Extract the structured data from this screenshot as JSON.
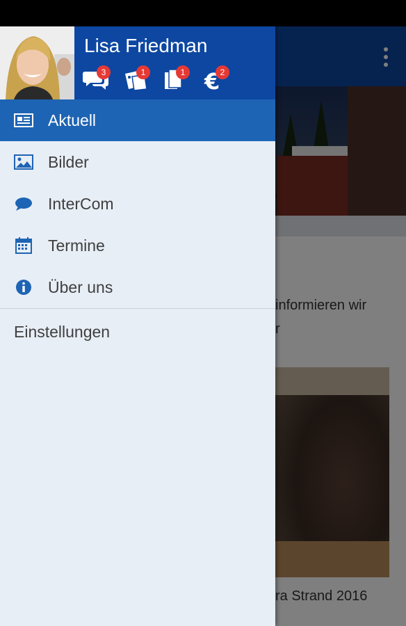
{
  "drawer": {
    "user_name": "Lisa Friedman",
    "badges": [
      {
        "icon": "chat-bubbles-icon",
        "count": "3"
      },
      {
        "icon": "tickets-icon",
        "count": "1"
      },
      {
        "icon": "documents-icon",
        "count": "1"
      },
      {
        "icon": "euro-icon",
        "count": "2"
      }
    ],
    "menu_items": [
      {
        "icon": "news-icon",
        "label": "Aktuell"
      },
      {
        "icon": "image-icon",
        "label": "Bilder"
      },
      {
        "icon": "chat-icon",
        "label": "InterCom"
      },
      {
        "icon": "calendar-icon",
        "label": "Termine"
      },
      {
        "icon": "info-icon",
        "label": "Über uns"
      }
    ],
    "settings_label": "Einstellungen"
  },
  "background": {
    "text_line_1": "informieren wir",
    "text_line_2": "r",
    "photo_caption": "ra Strand 2016"
  },
  "colors": {
    "primary": "#0d47a1",
    "active_item": "#1e64b4",
    "drawer_bg": "#e7eef6",
    "badge": "#e53935"
  }
}
